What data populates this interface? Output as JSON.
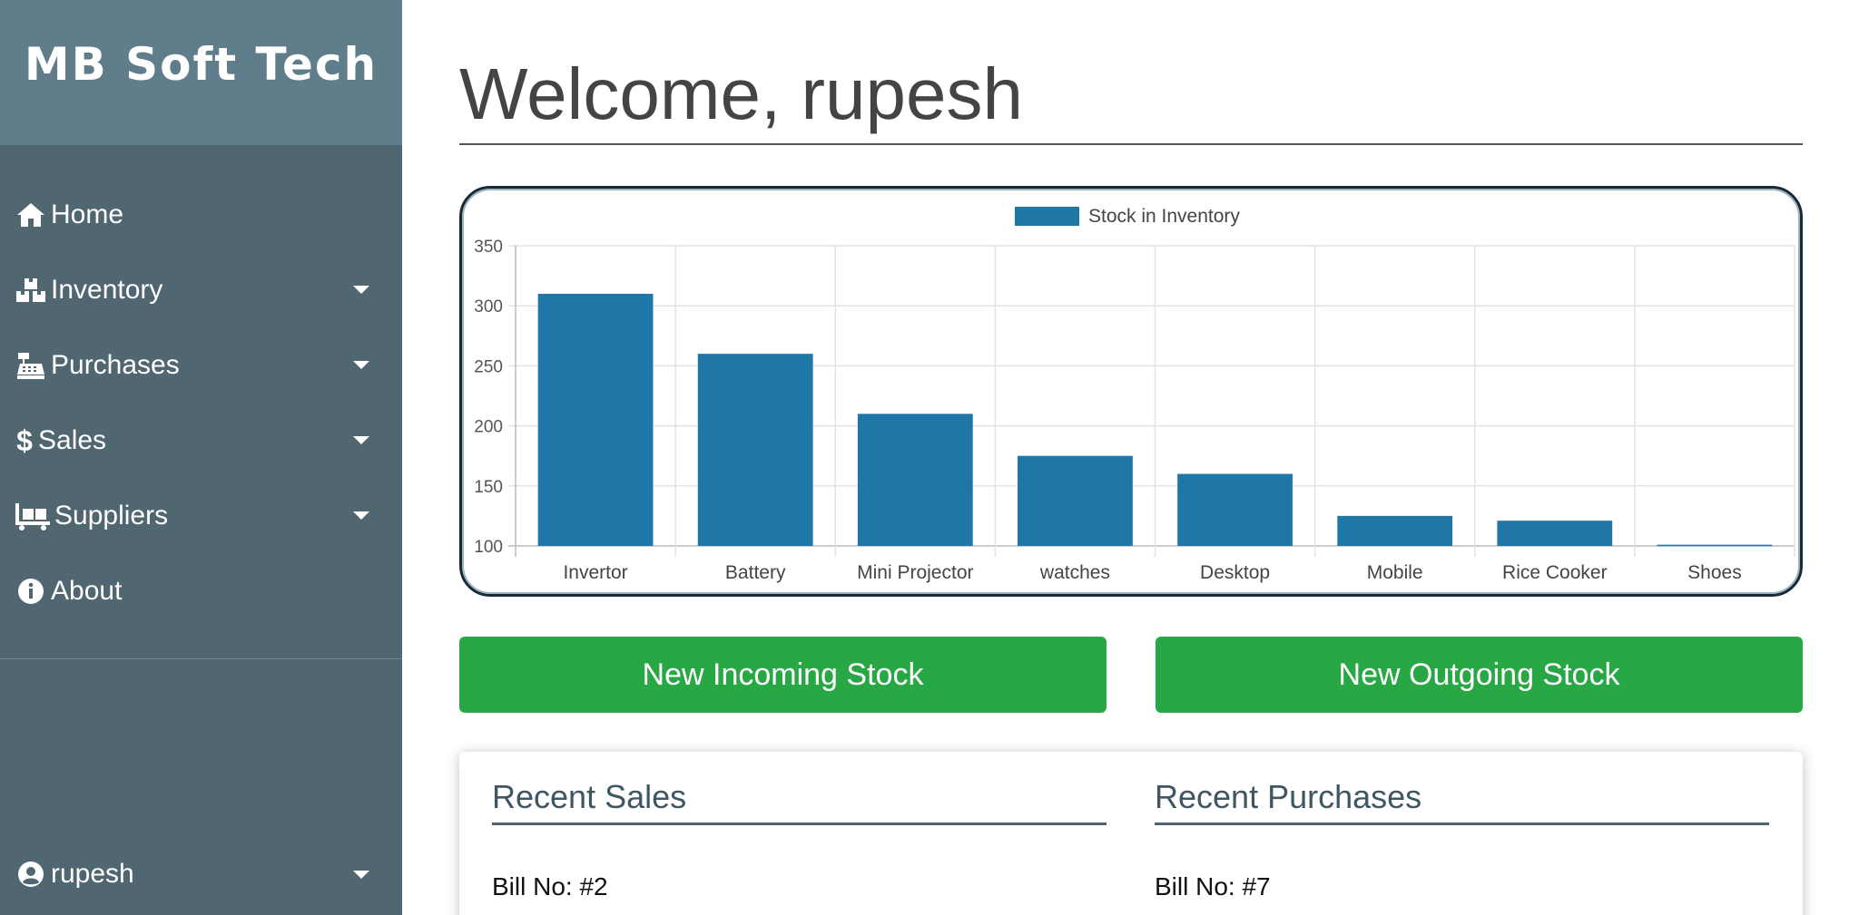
{
  "brand": {
    "name": "MB Soft Tech"
  },
  "sidebar": {
    "items": [
      {
        "label": "Home",
        "icon": "home-icon",
        "has_dropdown": false
      },
      {
        "label": "Inventory",
        "icon": "boxes-icon",
        "has_dropdown": true
      },
      {
        "label": "Purchases",
        "icon": "cash-register-icon",
        "has_dropdown": true
      },
      {
        "label": "Sales",
        "icon": "dollar-icon",
        "has_dropdown": true
      },
      {
        "label": "Suppliers",
        "icon": "dolly-flatbed-icon",
        "has_dropdown": true
      },
      {
        "label": "About",
        "icon": "info-circle-icon",
        "has_dropdown": false
      }
    ],
    "user": {
      "name": "rupesh",
      "icon": "user-circle-icon"
    }
  },
  "main": {
    "title": "Welcome, rupesh",
    "buttons": {
      "incoming": "New Incoming Stock",
      "outgoing": "New Outgoing Stock"
    },
    "recent": {
      "sales_title": "Recent Sales",
      "purchases_title": "Recent Purchases",
      "sales_first_bill": "Bill No: #2",
      "purchases_first_bill": "Bill No: #7"
    }
  },
  "colors": {
    "sidebar_bg": "#506670",
    "brand_bg": "#607d8b",
    "bar_color": "#1f77a8",
    "button_green": "#28a745"
  },
  "chart_data": {
    "type": "bar",
    "categories": [
      "Invertor",
      "Battery",
      "Mini Projector",
      "watches",
      "Desktop",
      "Mobile",
      "Rice Cooker",
      "Shoes"
    ],
    "series": [
      {
        "name": "Stock in Inventory",
        "values": [
          310,
          260,
          210,
          175,
          160,
          125,
          121,
          101
        ]
      }
    ],
    "ylim": [
      100,
      350
    ],
    "yticks": [
      100,
      150,
      200,
      250,
      300,
      350
    ],
    "legend": "top-center",
    "grid": true
  }
}
